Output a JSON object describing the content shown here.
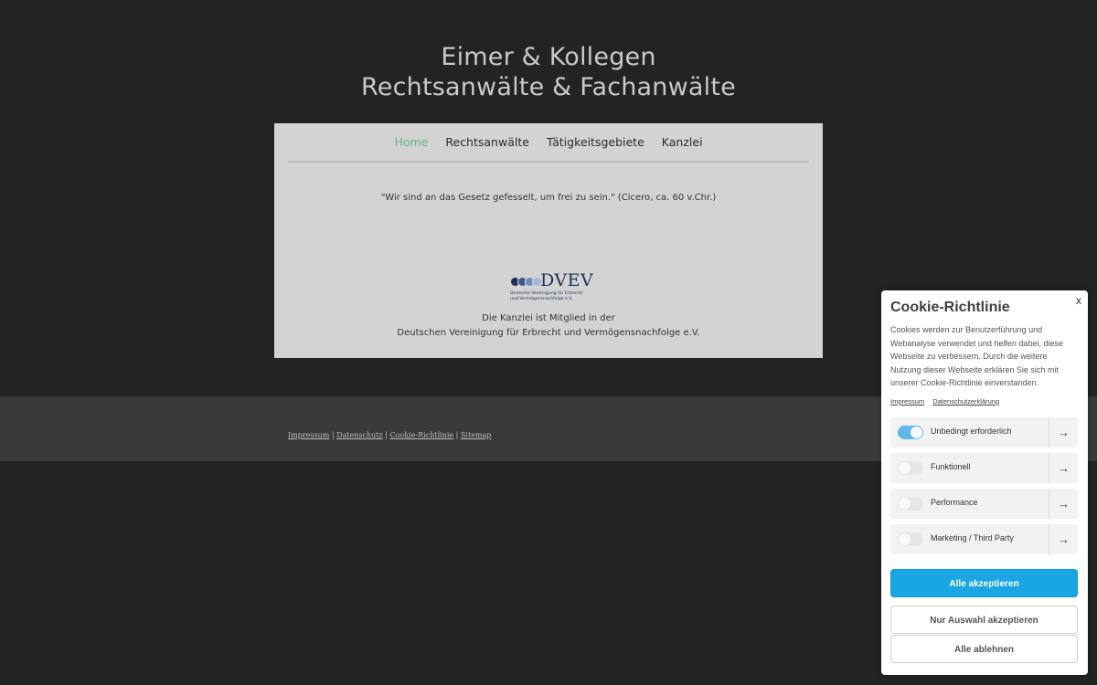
{
  "header": {
    "title_line1": "Eimer & Kollegen",
    "title_line2": "Rechtsanwälte & Fachanwälte"
  },
  "nav": {
    "items": [
      {
        "label": "Home",
        "active": true
      },
      {
        "label": "Rechtsanwälte",
        "active": false
      },
      {
        "label": "Tätigkeitsgebiete",
        "active": false
      },
      {
        "label": "Kanzlei",
        "active": false
      }
    ],
    "active_color": "#6db38a"
  },
  "main": {
    "quote": "\"Wir sind an das Gesetz gefesselt, um frei zu sein.\" (Cicero, ca. 60 v.Chr.)",
    "logo": {
      "brand": "DVEV",
      "sub_line1": "Deutsche Vereinigung für Erbrecht",
      "sub_line2": "und Vermögensnachfolge e.V.",
      "dot_colors": [
        "#1e2f5a",
        "#3c5a8c",
        "#6f8ab8",
        "#a5b7d4"
      ]
    },
    "member_line1": "Die Kanzlei ist Mitglied in der",
    "member_line2": "Deutschen Vereinigung für Erbrecht und Vermögensnachfolge e.V."
  },
  "footer": {
    "links": [
      "Impressum",
      "Datenschutz",
      "Cookie-Richtlinie",
      "Sitemap"
    ],
    "separator": " | "
  },
  "cookie": {
    "close": "x",
    "title": "Cookie-Richtlinie",
    "description": "Cookies werden zur Benutzerführung und Webanalyse verwendet und helfen dabei, diese Webseite zu verbessern. Durch die weitere Nutzung dieser Webseite erklären Sie sich mit unserer Cookie-Richtlinie einverstanden.",
    "link_impressum": "Impressum",
    "link_datenschutz": "Datenschutzerklärung",
    "categories": [
      {
        "label": "Unbedingt erforderlich",
        "enabled": true
      },
      {
        "label": "Funktionell",
        "enabled": false
      },
      {
        "label": "Performance",
        "enabled": false
      },
      {
        "label": "Marketing / Third Party",
        "enabled": false
      }
    ],
    "arrow_icon": "→",
    "accept_all": "Alle akzeptieren",
    "accept_selection": "Nur Auswahl akzeptieren",
    "reject_all": "Alle ablehnen",
    "accent_color": "#1aa5e3"
  }
}
